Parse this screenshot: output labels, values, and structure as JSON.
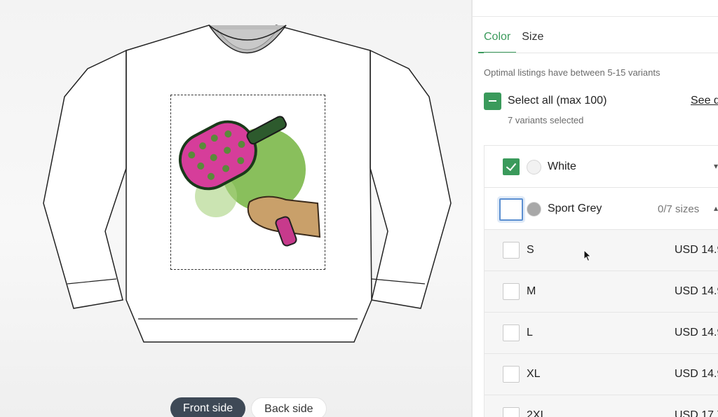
{
  "preview": {
    "sides": [
      {
        "label": "Front side",
        "active": true
      },
      {
        "label": "Back side",
        "active": false
      }
    ]
  },
  "panel": {
    "tabs": [
      {
        "label": "Color",
        "active": true
      },
      {
        "label": "Size",
        "active": false
      }
    ],
    "hint": "Optimal listings have between 5-15 variants",
    "select_all_label": "Select all (max 100)",
    "see_link": "See d",
    "selected_count": "7 variants selected",
    "colors": [
      {
        "name": "White",
        "checked": true,
        "swatch": "#f2f2f2",
        "meta": "",
        "expanded": false
      },
      {
        "name": "Sport Grey",
        "checked": false,
        "swatch": "#a8a8a8",
        "meta": "0/7 sizes",
        "expanded": true
      }
    ],
    "sizes": [
      {
        "name": "S",
        "price": "USD 14.9"
      },
      {
        "name": "M",
        "price": "USD 14.9"
      },
      {
        "name": "L",
        "price": "USD 14.9"
      },
      {
        "name": "XL",
        "price": "USD 14.9"
      },
      {
        "name": "2XL",
        "price": "USD 17.7"
      }
    ]
  },
  "colors": {
    "accent": "#3a9a5b",
    "toggle_active": "#3e4956",
    "paddle_pink": "#d63d9a",
    "splash_green": "#7cb84a"
  }
}
